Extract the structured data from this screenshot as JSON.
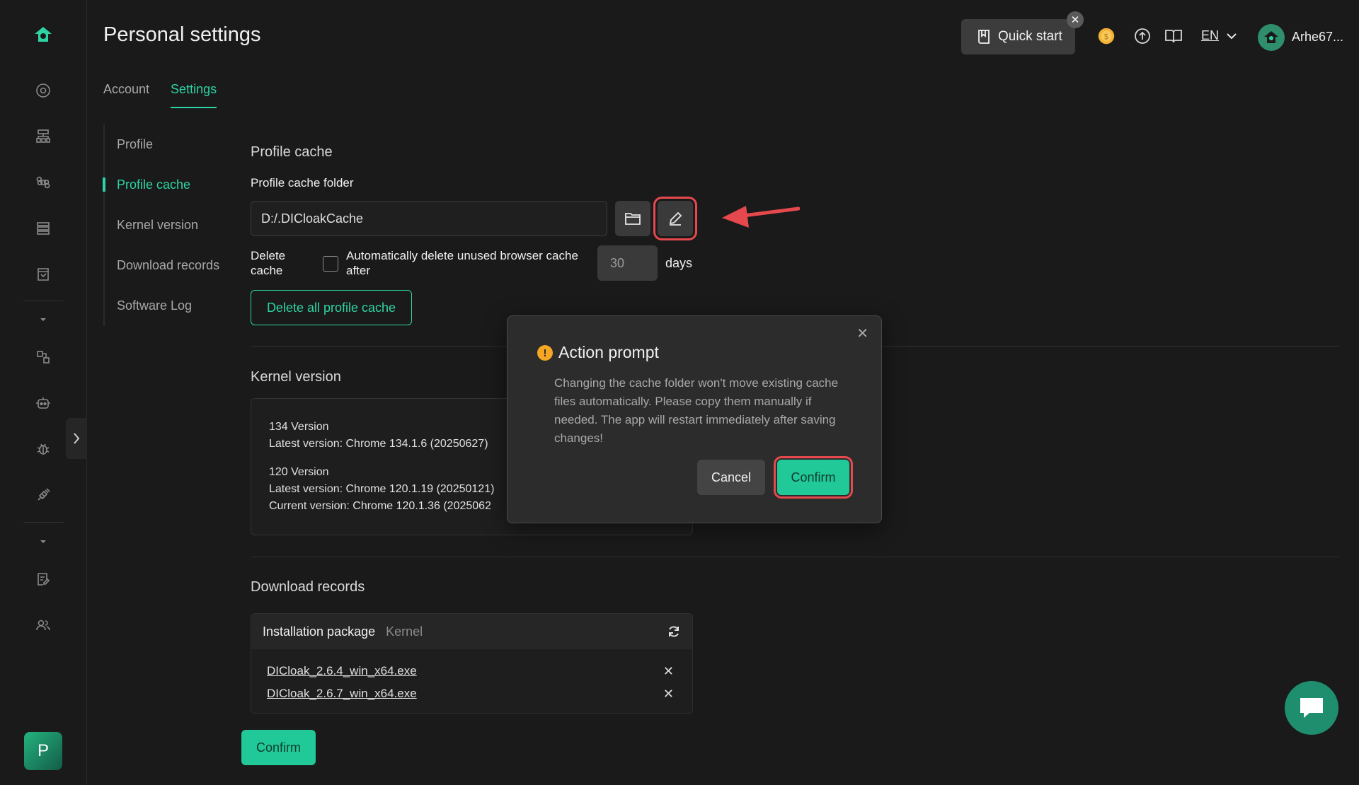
{
  "header": {
    "title": "Personal settings",
    "quick_start": "Quick start",
    "quick_start_close": "✕",
    "language": "EN",
    "user_name": "Arhe67..."
  },
  "tabs": [
    {
      "label": "Account"
    },
    {
      "label": "Settings"
    }
  ],
  "subnav": [
    {
      "label": "Profile"
    },
    {
      "label": "Profile cache"
    },
    {
      "label": "Kernel version"
    },
    {
      "label": "Download records"
    },
    {
      "label": "Software Log"
    }
  ],
  "profile_cache": {
    "section_title": "Profile cache",
    "folder_label": "Profile cache folder",
    "folder_value": "D:/.DICloakCache",
    "delete_label": "Delete cache",
    "auto_delete_text": "Automatically delete unused browser cache after",
    "days_value": "30",
    "days_label": "days",
    "delete_all_button": "Delete all profile cache"
  },
  "kernel": {
    "section_title": "Kernel version",
    "v134_title": "134 Version",
    "v134_latest": "Latest version: Chrome 134.1.6 (20250627)",
    "v120_title": "120 Version",
    "v120_latest": "Latest version: Chrome 120.1.19 (20250121)",
    "v120_current": "Current version: Chrome 120.1.36 (2025062"
  },
  "downloads": {
    "section_title": "Download records",
    "tab_active": "Installation package",
    "tab_other": "Kernel",
    "files": [
      {
        "name": "DICloak_2.6.4_win_x64.exe"
      },
      {
        "name": "DICloak_2.6.7_win_x64.exe"
      }
    ],
    "remove_glyph": "✕"
  },
  "confirm_button": "Confirm",
  "rail": {
    "avatar_letter": "P"
  },
  "modal": {
    "title": "Action prompt",
    "warn_glyph": "!",
    "close_glyph": "✕",
    "message": "Changing the cache folder won't move existing cache files automatically. Please copy them manually if needed. The app will restart immediately after saving changes!",
    "cancel": "Cancel",
    "confirm": "Confirm"
  },
  "colors": {
    "accent": "#20c997",
    "highlight": "#e5484d",
    "warning": "#f5a623",
    "background": "#1a1a1a"
  }
}
